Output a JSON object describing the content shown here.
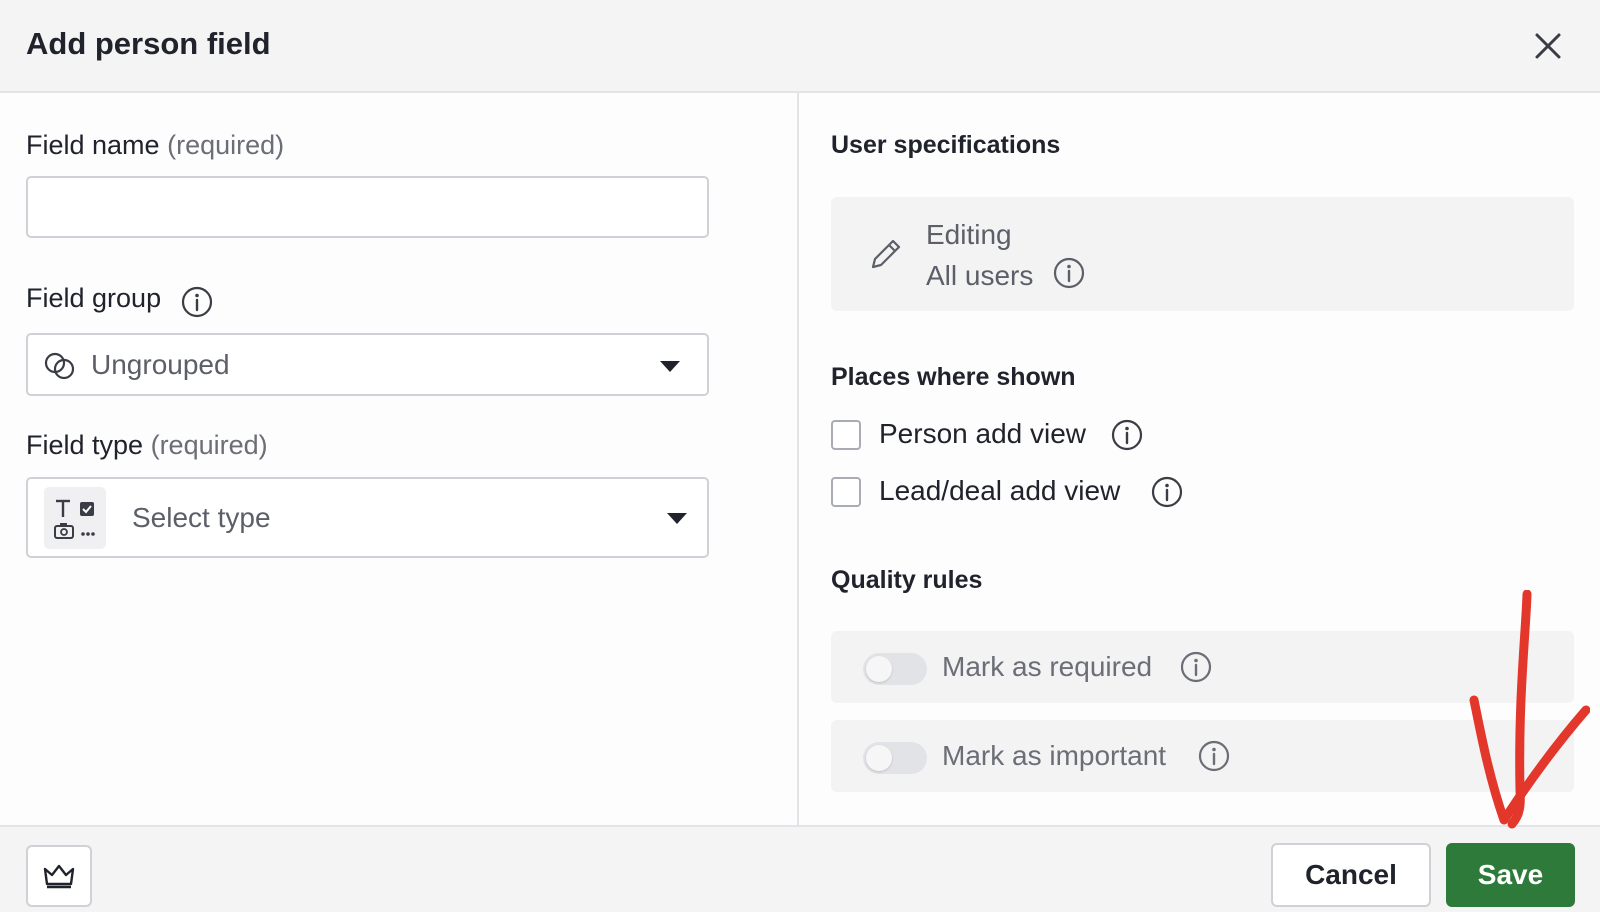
{
  "header": {
    "title": "Add person field",
    "close_icon": "close-icon"
  },
  "left": {
    "field_name": {
      "label": "Field name",
      "hint": "(required)",
      "value": "",
      "placeholder": ""
    },
    "field_group": {
      "label": "Field group",
      "info_icon": "info-icon",
      "selected": "Ungrouped",
      "icon": "ungrouped-circles-icon",
      "caret_icon": "caret-down-icon"
    },
    "field_type": {
      "label": "Field type",
      "hint": "(required)",
      "selected": "Select type",
      "icon": "field-types-icon",
      "caret_icon": "caret-down-icon"
    }
  },
  "right": {
    "user_specifications": {
      "title": "User specifications",
      "icon": "pencil-icon",
      "line1": "Editing",
      "line2": "All users"
    },
    "places": {
      "title": "Places where shown",
      "items": [
        {
          "label": "Person add view",
          "checked": false
        },
        {
          "label": "Lead/deal add view",
          "checked": false
        }
      ]
    },
    "quality_rules": {
      "title": "Quality rules",
      "items": [
        {
          "label": "Mark as required",
          "enabled": false
        },
        {
          "label": "Mark as important",
          "enabled": false
        }
      ]
    }
  },
  "footer": {
    "crown_icon": "crown-icon",
    "cancel_label": "Cancel",
    "save_label": "Save"
  },
  "colors": {
    "save_green": "#2d7a3a",
    "annotation_red": "#e2372a",
    "header_bg": "#f4f4f5"
  }
}
